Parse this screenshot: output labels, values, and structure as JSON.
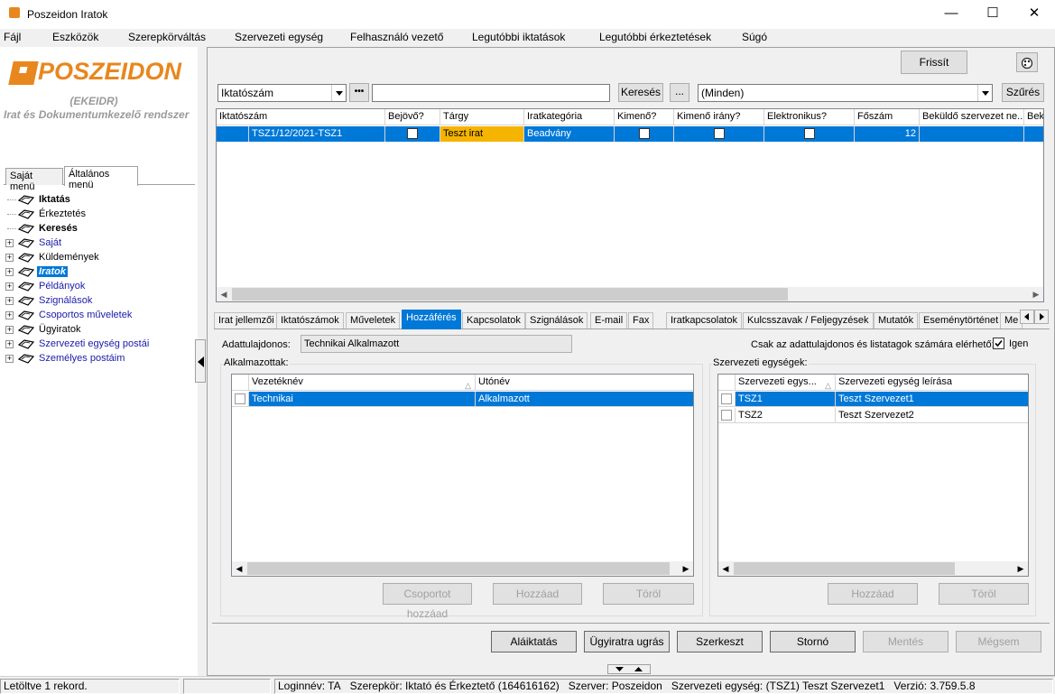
{
  "window": {
    "title": "Poszeidon Iratok",
    "minimize": "—",
    "maximize": "☐",
    "close": "✕"
  },
  "menu": [
    "Fájl",
    "Eszközök",
    "Szerepkörváltás",
    "Szervezeti egység",
    "Felhasználó vezető",
    "Legutóbbi iktatások",
    "Legutóbbi érkeztetések",
    "Súgó"
  ],
  "logo": {
    "name": "POSZEIDON",
    "subtitle1": "(EKEIDR)",
    "subtitle2": "Irat és Dokumentumkezelő rendszer"
  },
  "menu_tabs": [
    "Saját menü",
    "Általános menü"
  ],
  "tree": [
    {
      "label": "Iktatás",
      "style": "bold",
      "expandable": false
    },
    {
      "label": "Érkeztetés",
      "style": "normal",
      "expandable": false
    },
    {
      "label": "Keresés",
      "style": "bold",
      "expandable": false
    },
    {
      "label": "Saját",
      "style": "blue",
      "expandable": true
    },
    {
      "label": "Küldemények",
      "style": "normal",
      "expandable": true
    },
    {
      "label": "Iratok",
      "style": "selected",
      "expandable": true
    },
    {
      "label": "Példányok",
      "style": "blue",
      "expandable": true
    },
    {
      "label": "Szignálások",
      "style": "blue",
      "expandable": true
    },
    {
      "label": "Csoportos műveletek",
      "style": "blue",
      "expandable": true
    },
    {
      "label": "Ügyiratok",
      "style": "normal",
      "expandable": true
    },
    {
      "label": "Szervezeti egység postái",
      "style": "blue",
      "expandable": true
    },
    {
      "label": "Személyes postáim",
      "style": "blue",
      "expandable": true
    }
  ],
  "toolbar": {
    "refresh": "Frissít",
    "palette_icon": "palette-icon"
  },
  "search": {
    "field": "Iktatószám",
    "more": "•••",
    "value": "",
    "search_button": "Keresés",
    "ellipsis_button": "...",
    "filter_value": "(Minden)",
    "filter_button": "Szűrés"
  },
  "grid": {
    "columns": [
      "Iktatószám",
      "Bejövő?",
      "Tárgy",
      "Iratkategória",
      "Kimenő?",
      "Kimenő irány?",
      "Elektronikus?",
      "Főszám",
      "Beküldő szervezet ne...",
      "Bek"
    ],
    "row": {
      "iktatoszam": "TSZ1/12/2021-TSZ1",
      "bejovo": false,
      "targy": "Teszt irat",
      "iratkategoria": "Beadvány",
      "kimeno": false,
      "kimeno_irany": false,
      "elektronikus": false,
      "foszam": "12",
      "bekuldo": "",
      "bek": ""
    }
  },
  "tabs": [
    "Irat jellemzői",
    "Iktatószámok",
    "Műveletek",
    "Hozzáférés",
    "Kapcsolatok",
    "Szignálások",
    "E-mail",
    "Fax",
    "Iratkapcsolatok",
    "Kulcsszavak / Feljegyzések",
    "Mutatók",
    "Eseménytörténet",
    "Me"
  ],
  "active_tab": "Hozzáférés",
  "access": {
    "owner_label": "Adattulajdonos:",
    "owner_value": "Technikai Alkalmazott",
    "only_owner_label": "Csak az adattulajdonos és listatagok számára elérhető:",
    "only_owner_checked": true,
    "only_owner_value": "Igen",
    "employees": {
      "legend": "Alkalmazottak:",
      "columns": [
        "Vezetéknév",
        "Utónév"
      ],
      "rows": [
        {
          "last": "Technikai",
          "first": "Alkalmazott"
        }
      ],
      "buttons": [
        "Csoportot hozzáad",
        "Hozzáad",
        "Töröl"
      ]
    },
    "units": {
      "legend": "Szervezeti egységek:",
      "columns": [
        "Szervezeti egys...",
        "Szervezeti egység leírása"
      ],
      "rows": [
        {
          "code": "TSZ1",
          "desc": "Teszt Szervezet1"
        },
        {
          "code": "TSZ2",
          "desc": "Teszt Szervezet2"
        }
      ],
      "buttons": [
        "Hozzáad",
        "Töröl"
      ]
    }
  },
  "actions": [
    "Aláiktatás",
    "Ügyiratra ugrás",
    "Szerkeszt",
    "Stornó",
    "Mentés",
    "Mégsem"
  ],
  "status": {
    "records": "Letöltve 1 rekord.",
    "empty": "",
    "login": "Loginnév: TA",
    "role": "Szerepkör: Iktató és Érkeztető (164616162)",
    "server": "Szerver: Poszeidon",
    "unit": "Szervezeti egység: (TSZ1) Teszt Szervezet1",
    "version": "Verzió: 3.759.5.8"
  }
}
